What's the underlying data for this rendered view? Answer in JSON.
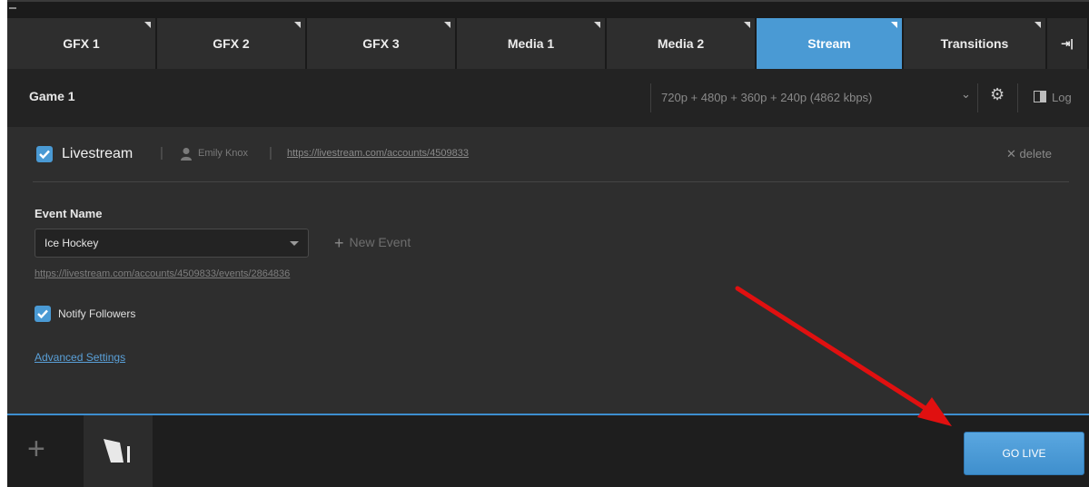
{
  "tabs": [
    {
      "label": "GFX 1",
      "active": false
    },
    {
      "label": "GFX 2",
      "active": false
    },
    {
      "label": "GFX 3",
      "active": false
    },
    {
      "label": "Media 1",
      "active": false
    },
    {
      "label": "Media 2",
      "active": false
    },
    {
      "label": "Stream",
      "active": true
    },
    {
      "label": "Transitions",
      "active": false
    }
  ],
  "tab_overflow_label": "⇥|",
  "header": {
    "title": "Game 1",
    "bitrate": "720p + 480p + 360p + 240p (4862 kbps)",
    "log_label": "Log"
  },
  "account": {
    "checked": true,
    "service": "Livestream",
    "user": "Emily Knox",
    "url": "https://livestream.com/accounts/4509833",
    "delete_label": "delete"
  },
  "event": {
    "label": "Event Name",
    "selected": "Ice Hockey",
    "new_event_label": "New Event",
    "url": "https://livestream.com/accounts/4509833/events/2864836"
  },
  "notify": {
    "checked": true,
    "label": "Notify Followers"
  },
  "advanced_label": "Advanced Settings",
  "go_live_label": "GO LIVE",
  "colors": {
    "accent": "#4a9ad4",
    "annotation_arrow": "#e01010"
  },
  "icons": [
    "user-icon",
    "gear-icon",
    "log-panel-icon",
    "plus-icon",
    "livestream-logo-icon",
    "close-icon",
    "check-icon",
    "chevron-down-icon"
  ]
}
